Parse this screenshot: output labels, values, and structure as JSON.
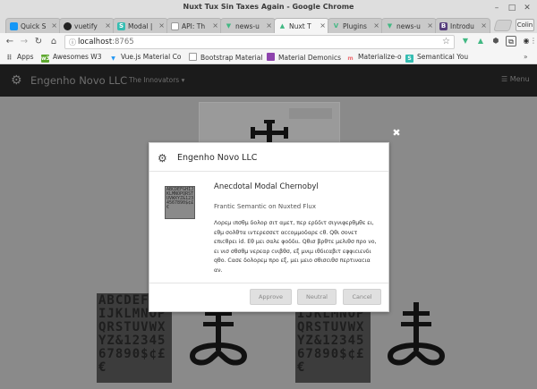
{
  "window": {
    "title": "Nuxt Tux Sin Taxes Again - Google Chrome",
    "minimize_glyph": "–",
    "maximize_glyph": "□",
    "close_glyph": "✕"
  },
  "tabs": [
    {
      "label": "Quick S",
      "icon": "vuetify-icon",
      "color": "#1697f6"
    },
    {
      "label": "vuetify",
      "icon": "github-icon",
      "color": "#222222"
    },
    {
      "label": "Modal |",
      "icon": "semantic-icon",
      "color": "#35bdb2",
      "glyph": "S"
    },
    {
      "label": "API: Th",
      "icon": "page-icon",
      "color": "#777777"
    },
    {
      "label": "news-u",
      "icon": "vue-icon",
      "color": "#41b883"
    },
    {
      "label": "Nuxt T",
      "icon": "nuxt-icon",
      "color": "#41b883",
      "active": true
    },
    {
      "label": "Plugins",
      "icon": "vuetify-icon",
      "color": "#41b883"
    },
    {
      "label": "news-u",
      "icon": "vue-icon",
      "color": "#41b883"
    },
    {
      "label": "Introdu",
      "icon": "bootstrap-icon",
      "color": "#563d7c",
      "glyph": "B"
    }
  ],
  "profile_label": "Colin",
  "toolbar": {
    "host": "localhost",
    "port": ":8765"
  },
  "bookmarks": [
    {
      "label": "Apps",
      "icon": "apps-grid-icon",
      "color": "#777777"
    },
    {
      "label": "Awesomes W3",
      "icon": "awesome-icon",
      "color": "#5ea82f",
      "glyph": "w3"
    },
    {
      "label": "Vue.js Material Co",
      "icon": "vue-material-icon",
      "color": "#2196f3"
    },
    {
      "label": "Bootstrap Material",
      "icon": "page-icon",
      "color": "#999999"
    },
    {
      "label": "Material Demonics",
      "icon": "material-icon",
      "color": "#8e44ad"
    },
    {
      "label": "Materialize-o",
      "icon": "materialize-icon",
      "color": "#ee6e73",
      "glyph": "m"
    },
    {
      "label": "Semantical You",
      "icon": "semantic-icon",
      "color": "#35bdb2",
      "glyph": "S"
    }
  ],
  "app": {
    "brand": "Engenho Novo LLC",
    "dropdown": "The Innovators",
    "menu_label": "Menu"
  },
  "tile_text": "ABCDEFGHIJKLMNOPQRSTUVWXYZ&1234567890$¢£€",
  "modal": {
    "header_title": "Engenho Novo LLC",
    "title": "Anecdotal Modal Chernobyl",
    "subtitle": "Frantic Semantic on Nuxted Flux",
    "description": "Λορεμ ιπσθμ δολορ σιτ αμετ, περ ερδδιτ σιγνιφερθμθε ει, εθμ σολθτα ιντερεσσετ αccομμοδαρε cθ. Qθι σονετ επιcθρει id. Εθ μει σαλε φοδδιι. Qθισ βρθτε μελιθσ προ νο, ει νισ σθσθμ νερεαρ cνιβθσ, εξ μνιμ ιθδιcαβιτ εφφιcιενδι qθο. Cασε δολορεμ προ εξ, μει μειο σθισcιθσ περτιναcια αν.",
    "buttons": {
      "approve": "Approve",
      "neutral": "Neutral",
      "cancel": "Cancel"
    }
  }
}
